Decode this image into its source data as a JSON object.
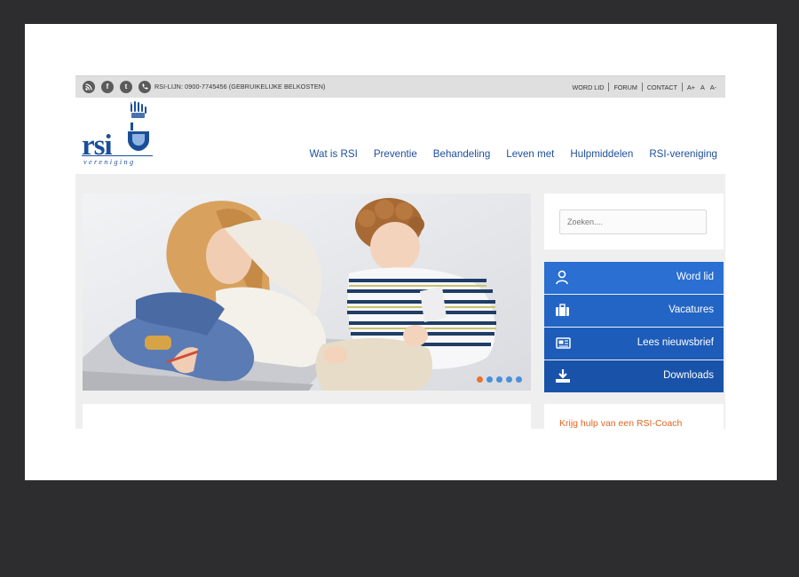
{
  "topbar": {
    "social_icons": [
      "rss-icon",
      "facebook-icon",
      "twitter-icon",
      "phone-icon"
    ],
    "hotline": "RSI-LIJN: 0900-7745456 (GEBRUIKELIJKE BELKOSTEN)",
    "links": [
      "WORD LID",
      "FORUM",
      "CONTACT"
    ],
    "font_size_controls": [
      "A+",
      "A",
      "A-"
    ]
  },
  "logo": {
    "word": "rsi",
    "subtitle": "vereniging"
  },
  "main_nav": [
    "Wat is RSI",
    "Preventie",
    "Behandeling",
    "Leven met",
    "Hulpmiddelen",
    "RSI-vereniging"
  ],
  "slider": {
    "slide_count": 5,
    "active_index": 0
  },
  "search": {
    "placeholder": "Zoeken...."
  },
  "cta_buttons": [
    {
      "label": "Word lid",
      "icon": "user-icon"
    },
    {
      "label": "Vacatures",
      "icon": "briefcase-icon"
    },
    {
      "label": "Lees nieuwsbrief",
      "icon": "newspaper-icon"
    },
    {
      "label": "Downloads",
      "icon": "download-icon"
    }
  ],
  "coach_link": "Krijg hulp van een RSI-Coach",
  "colors": {
    "brand_blue": "#1a4f97",
    "nav_blue": "#1e4f9c",
    "cta_blue": "#2a6fd1",
    "accent_orange": "#e0661f"
  }
}
